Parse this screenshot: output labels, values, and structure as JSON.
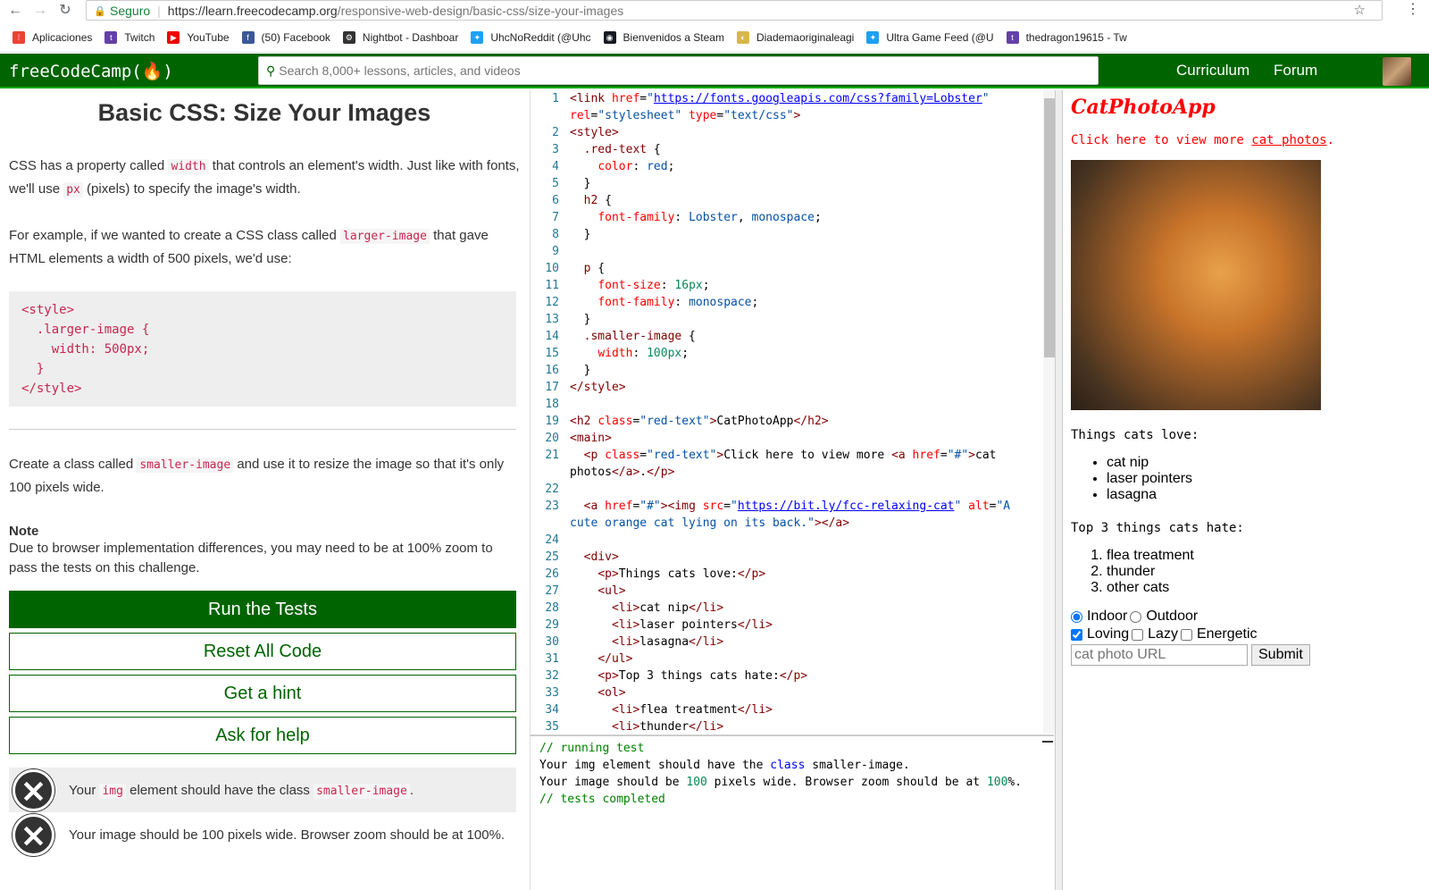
{
  "browser": {
    "secure_label": "Seguro",
    "url_host": "https://learn.freecodecamp.org",
    "url_path": "/responsive-web-design/basic-css/size-your-images",
    "bookmarks": [
      {
        "label": "Aplicaciones",
        "icon": "apps-grid-icon"
      },
      {
        "label": "Twitch",
        "icon": "twitch-icon"
      },
      {
        "label": "YouTube",
        "icon": "youtube-icon"
      },
      {
        "label": "(50) Facebook",
        "icon": "facebook-icon"
      },
      {
        "label": "Nightbot - Dashboar",
        "icon": "nightbot-icon"
      },
      {
        "label": "UhcNoReddit (@Uhc",
        "icon": "twitter-icon"
      },
      {
        "label": "Bienvenidos a Steam",
        "icon": "steam-icon"
      },
      {
        "label": "Diademaoriginaleagi",
        "icon": "bookmark-icon"
      },
      {
        "label": "Ultra Game Feed (@U",
        "icon": "twitter-icon"
      },
      {
        "label": "thedragon19615 - Tw",
        "icon": "twitch-icon"
      }
    ]
  },
  "header": {
    "logo": "freeCodeCamp(🔥)",
    "search_placeholder": "Search 8,000+ lessons, articles, and videos",
    "nav": [
      "Curriculum",
      "Forum"
    ]
  },
  "lesson": {
    "title": "Basic CSS: Size Your Images",
    "p1_a": "CSS has a property called ",
    "p1_code1": "width",
    "p1_b": " that controls an element's width. Just like with fonts, we'll use ",
    "p1_code2": "px",
    "p1_c": " (pixels) to specify the image's width.",
    "p2_a": "For example, if we wanted to create a CSS class called ",
    "p2_code": "larger-image",
    "p2_b": " that gave HTML elements a width of 500 pixels, we'd use:",
    "example_code": "<style>\n  .larger-image {\n    width: 500px;\n  }\n</style>",
    "p3_a": "Create a class called ",
    "p3_code": "smaller-image",
    "p3_b": " and use it to resize the image so that it's only 100 pixels wide.",
    "note_head": "Note",
    "note_text": "Due to browser implementation differences, you may need to be at 100% zoom to pass the tests on this challenge.",
    "buttons": {
      "run": "Run the Tests",
      "reset": "Reset All Code",
      "hint": "Get a hint",
      "help": "Ask for help"
    },
    "tests": [
      {
        "a": "Your ",
        "code1": "img",
        "b": " element should have the class ",
        "code2": "smaller-image",
        "c": "."
      },
      {
        "text": "Your image should be 100 pixels wide. Browser zoom should be at 100%."
      }
    ]
  },
  "editor": {
    "line_numbers": [
      "1",
      "",
      "2",
      "3",
      "4",
      "5",
      "6",
      "7",
      "8",
      "9",
      "10",
      "11",
      "12",
      "13",
      "14",
      "15",
      "16",
      "17",
      "18",
      "19",
      "20",
      "21",
      "",
      "22",
      "23",
      "",
      "24",
      "25",
      "26",
      "27",
      "28",
      "29",
      "30",
      "31",
      "32",
      "33",
      "34",
      "35"
    ]
  },
  "output": {
    "running": "// running test",
    "line1_a": "Your img element should have the ",
    "line1_kw": "class",
    "line1_b": " smaller-image.",
    "line2_a": "Your image should be ",
    "line2_n1": "100",
    "line2_b": " pixels wide. Browser zoom should be at ",
    "line2_n2": "100",
    "line2_c": "%.",
    "completed": "// tests completed"
  },
  "preview": {
    "title": "CatPhotoApp",
    "p_a": "Click here to view more ",
    "p_link": "cat photos",
    "p_b": ".",
    "love_heading": "Things cats love:",
    "love_items": [
      "cat nip",
      "laser pointers",
      "lasagna"
    ],
    "hate_heading": "Top 3 things cats hate:",
    "hate_items": [
      "flea treatment",
      "thunder",
      "other cats"
    ],
    "radios": [
      "Indoor",
      "Outdoor"
    ],
    "checkboxes": [
      "Loving",
      "Lazy",
      "Energetic"
    ],
    "url_placeholder": "cat photo URL",
    "submit": "Submit"
  },
  "colors": {
    "brand": "#006400",
    "error": "#333333",
    "accent_red": "#ff0000"
  }
}
